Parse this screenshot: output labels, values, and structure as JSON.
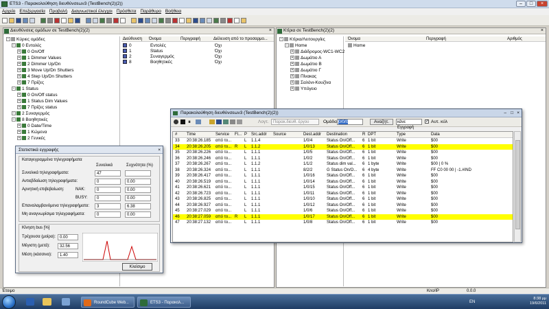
{
  "window": {
    "title": "ETS3 - Παρακολούθηση διευθύνσεων3 (TestBench(2)(2))"
  },
  "menu": [
    "Αρχείο",
    "Επεξεργασία",
    "Προβολή",
    "Διαγνωστικοί έλεγχοι",
    "Πρόσθετα",
    "Παράθυρο",
    "Βοήθεια"
  ],
  "left_pane": {
    "title": "Διευθύνσεις ομάδων σε TestBench(2)(2)",
    "tree": [
      {
        "level": 0,
        "icon": "root",
        "label": "Κύριες ομάδες"
      },
      {
        "level": 1,
        "icon": "group",
        "label": "0 Εντολές"
      },
      {
        "level": 2,
        "icon": "group",
        "label": "0 On/Off"
      },
      {
        "level": 2,
        "icon": "group",
        "label": "1 Dimmer Values"
      },
      {
        "level": 2,
        "icon": "group",
        "label": "2 Dimmer Up/Dn"
      },
      {
        "level": 2,
        "icon": "group",
        "label": "3 Move Up/Dn Shutters"
      },
      {
        "level": 2,
        "icon": "group",
        "label": "4 Step Up/Dn Shutters"
      },
      {
        "level": 2,
        "icon": "group",
        "label": "7 Πρίζες"
      },
      {
        "level": 1,
        "icon": "group",
        "label": "1 Status"
      },
      {
        "level": 2,
        "icon": "group",
        "label": "0 On/Off status"
      },
      {
        "level": 2,
        "icon": "group",
        "label": "1 Status Dim Values"
      },
      {
        "level": 2,
        "icon": "group",
        "label": "7 Πρίζες status"
      },
      {
        "level": 1,
        "icon": "group",
        "label": "2 Συναγερμός"
      },
      {
        "level": 1,
        "icon": "group",
        "label": "8 Βοηθητικές"
      },
      {
        "level": 2,
        "icon": "group",
        "label": "0 Date/Time"
      },
      {
        "level": 2,
        "icon": "group",
        "label": "1 Κώμενα"
      },
      {
        "level": 2,
        "icon": "group",
        "label": "2 Γενικές"
      }
    ],
    "columns": [
      "Διεύθυνση",
      "Όνομα",
      "Περιγραφή",
      "Διέλευση από το προσαρμο..."
    ],
    "rows": [
      {
        "addr": "0",
        "name": "Εντολές",
        "desc": "",
        "pass": "Όχι"
      },
      {
        "addr": "1",
        "name": "Status",
        "desc": "",
        "pass": "Όχι"
      },
      {
        "addr": "2",
        "name": "Συναγερμός",
        "desc": "",
        "pass": "Όχι"
      },
      {
        "addr": "8",
        "name": "Βοηθητικές",
        "desc": "",
        "pass": "Όχι"
      }
    ]
  },
  "right_pane": {
    "title": "Κτίρια σε TestBench(2)(2)",
    "tree": [
      {
        "level": 0,
        "label": "Κτίρια/Λειτουργίες"
      },
      {
        "level": 1,
        "label": "Home"
      },
      {
        "level": 2,
        "label": "Διάδρομος-WC1-WC2"
      },
      {
        "level": 2,
        "label": "Δωμάτιο Α"
      },
      {
        "level": 2,
        "label": "Δωμάτιο Β"
      },
      {
        "level": 2,
        "label": "Δωμάτιο Γ"
      },
      {
        "level": 2,
        "label": "Πίνακας"
      },
      {
        "level": 2,
        "label": "Σαλόνι-Κουζίνα"
      },
      {
        "level": 2,
        "label": "Υπόγειο"
      }
    ],
    "columns": [
      "Όνομα",
      "Περιγραφή",
      "Αριθμός"
    ],
    "rows": [
      {
        "name": "Home",
        "desc": "",
        "num": ""
      }
    ]
  },
  "monitor": {
    "title": "Παρακολούθηση διευθύνσεων3 (TestBench(2)(2))",
    "toolbar": {
      "filter_label": "Λογτ.",
      "filter_placeholder": "Παρακ.διευθ. έργου",
      "group_label": "Ομάδα:",
      "group_value": "0/0/0",
      "search_button": "Αναζητ.",
      "send_value": "κάνε Εγγραφή",
      "auto_label": "Αυτ. κύλ"
    },
    "columns": [
      "#",
      "Time",
      "Service",
      "Fl...",
      "P",
      "Src.addr",
      "Source",
      "Dest.addr",
      "Destination",
      "R",
      "DPT",
      "Type",
      "Data"
    ],
    "rows": [
      {
        "n": "33",
        "time": "20:38:26.185",
        "svc": "από το...",
        "fl": "",
        "p": "L",
        "src": "1.1.4",
        "source": "",
        "dst": "1/0/4",
        "dest": "Status On/Off...",
        "r": "6",
        "dpt": "1 bit",
        "type": "Write",
        "data": "$00",
        "hl": false
      },
      {
        "n": "34",
        "time": "20:38:26.205",
        "svc": "από το...",
        "fl": "R",
        "p": "L",
        "src": "1.1.2",
        "source": "",
        "dst": "1/0/13",
        "dest": "Status On/Off...",
        "r": "6",
        "dpt": "1 bit",
        "type": "Write",
        "data": "$00",
        "hl": true
      },
      {
        "n": "35",
        "time": "20:38:26.226",
        "svc": "από το...",
        "fl": "",
        "p": "L",
        "src": "1.1.1",
        "source": "",
        "dst": "1/0/5",
        "dest": "Status On/Off...",
        "r": "6",
        "dpt": "1 bit",
        "type": "Write",
        "data": "$00",
        "hl": false
      },
      {
        "n": "36",
        "time": "20:38:26.246",
        "svc": "από το...",
        "fl": "",
        "p": "L",
        "src": "1.1.1",
        "source": "",
        "dst": "1/0/2",
        "dest": "Status On/Off...",
        "r": "6",
        "dpt": "1 bit",
        "type": "Write",
        "data": "$00",
        "hl": false
      },
      {
        "n": "37",
        "time": "20:38:26.267",
        "svc": "από το...",
        "fl": "",
        "p": "L",
        "src": "1.1.2",
        "source": "",
        "dst": "1/1/2",
        "dest": "Status dim val...",
        "r": "6",
        "dpt": "1 byte",
        "type": "Write",
        "data": "$00 | 0 %",
        "hl": false
      },
      {
        "n": "38",
        "time": "20:38:26.324",
        "svc": "από το...",
        "fl": "",
        "p": "L",
        "src": "1.1.1",
        "source": "",
        "dst": "8/2/2",
        "dest": "G Status On/O...",
        "r": "6",
        "dpt": "4 byte",
        "type": "Write",
        "data": "FF C0 00 00 | -1.#IND",
        "hl": false
      },
      {
        "n": "39",
        "time": "20:38:26.417",
        "svc": "από το...",
        "fl": "",
        "p": "L",
        "src": "1.1.1",
        "source": "",
        "dst": "1/0/16",
        "dest": "Status On/Off...",
        "r": "6",
        "dpt": "1 bit",
        "type": "Write",
        "data": "$00",
        "hl": false
      },
      {
        "n": "40",
        "time": "20:38:26.519",
        "svc": "από το...",
        "fl": "",
        "p": "L",
        "src": "1.1.1",
        "source": "",
        "dst": "1/0/14",
        "dest": "Status On/Off...",
        "r": "6",
        "dpt": "1 bit",
        "type": "Write",
        "data": "$00",
        "hl": false
      },
      {
        "n": "41",
        "time": "20:38:26.621",
        "svc": "από το...",
        "fl": "",
        "p": "L",
        "src": "1.1.1",
        "source": "",
        "dst": "1/0/15",
        "dest": "Status On/Off...",
        "r": "6",
        "dpt": "1 bit",
        "type": "Write",
        "data": "$00",
        "hl": false
      },
      {
        "n": "42",
        "time": "20:38:26.723",
        "svc": "από το...",
        "fl": "",
        "p": "L",
        "src": "1.1.1",
        "source": "",
        "dst": "1/0/11",
        "dest": "Status On/Off...",
        "r": "6",
        "dpt": "1 bit",
        "type": "Write",
        "data": "$00",
        "hl": false
      },
      {
        "n": "43",
        "time": "20:38:26.825",
        "svc": "από το...",
        "fl": "",
        "p": "L",
        "src": "1.1.1",
        "source": "",
        "dst": "1/0/10",
        "dest": "Status On/Off...",
        "r": "6",
        "dpt": "1 bit",
        "type": "Write",
        "data": "$00",
        "hl": false
      },
      {
        "n": "44",
        "time": "20:38:26.927",
        "svc": "από το...",
        "fl": "",
        "p": "L",
        "src": "1.1.1",
        "source": "",
        "dst": "1/0/12",
        "dest": "Status On/Off...",
        "r": "6",
        "dpt": "1 bit",
        "type": "Write",
        "data": "$00",
        "hl": false
      },
      {
        "n": "45",
        "time": "20:38:27.029",
        "svc": "από το...",
        "fl": "",
        "p": "L",
        "src": "1.1.1",
        "source": "",
        "dst": "1/0/6",
        "dest": "Status On/Off...",
        "r": "6",
        "dpt": "1 bit",
        "type": "Write",
        "data": "$00",
        "hl": false
      },
      {
        "n": "46",
        "time": "20:38:27.059",
        "svc": "από το...",
        "fl": "R",
        "p": "L",
        "src": "1.1.1",
        "source": "",
        "dst": "1/0/17",
        "dest": "Status On/Off...",
        "r": "6",
        "dpt": "1 bit",
        "type": "Write",
        "data": "$00",
        "hl": true
      },
      {
        "n": "47",
        "time": "20:38:27.132",
        "svc": "από το...",
        "fl": "",
        "p": "L",
        "src": "1.1.1",
        "source": "",
        "dst": "1/0/8",
        "dest": "Status On/Off...",
        "r": "6",
        "dpt": "1 bit",
        "type": "Write",
        "data": "$00",
        "hl": false
      }
    ]
  },
  "stats": {
    "title": "Στατιστικά εγγραφής",
    "section1": "Καταγεγραμμένα τηλεγραφήματα",
    "col_total": "Συνολικά",
    "col_freq": "Συχνότητα (%)",
    "rows": [
      {
        "label": "Συνολικά τηλεγραφήματα:",
        "total": "47",
        "freq": ""
      },
      {
        "label": "Αντιεβδαίωση τηλεγραφήματα:",
        "total": "0",
        "freq": "0.00"
      },
      {
        "label": "Αρνητική επιβεβαίωση:",
        "sub": "NAK:",
        "total": "0",
        "freq": "0.00"
      },
      {
        "label": "",
        "sub": "BUSY:",
        "total": "0",
        "freq": "0.00"
      },
      {
        "label": "Επαναλαμβανόμενα τηλεγραφήματα:",
        "total": "3",
        "freq": "6.38"
      },
      {
        "label": "Μη αναγνωρίσιμα τηλεγραφήματα:",
        "total": "0",
        "freq": "0.00"
      }
    ],
    "section2": "Κίνηση bus [%]",
    "bus": [
      {
        "label": "Τρέχουσα (μοίρα):",
        "value": "0.00"
      },
      {
        "label": "Μέγιστη (μετά):",
        "value": "32.56"
      },
      {
        "label": "Μέση (κάσσινα):",
        "value": "1.40"
      }
    ],
    "close_button": "Κλείσιμο"
  },
  "statusbar": {
    "left": "Έτοιμο",
    "right": "Kno/IP",
    "coords": "0.0.0"
  },
  "taskbar": {
    "apps": [
      {
        "label": "RoundCube Web...",
        "icon": "firefox-icon",
        "color": "#e06a1a"
      },
      {
        "label": "ETS3 - Παρακολ...",
        "icon": "ets-icon",
        "color": "#2e6b3a"
      }
    ],
    "lang": "EN",
    "time": "8:38 μμ",
    "date": "19/6/2011"
  },
  "accent": "#ffff00"
}
